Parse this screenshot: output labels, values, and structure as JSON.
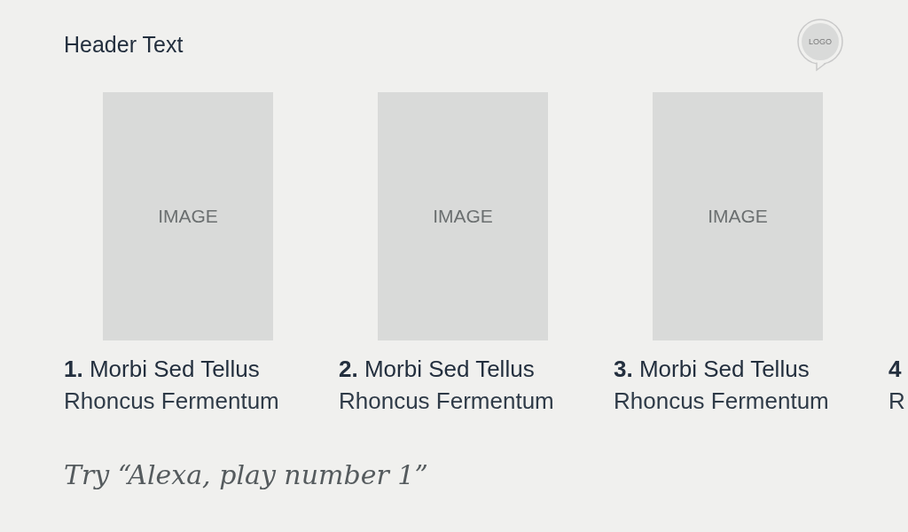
{
  "header": {
    "title": "Header Text",
    "logo": "LOGO"
  },
  "items": [
    {
      "image": "IMAGE",
      "number": "1.",
      "title": "Morbi Sed Tellus",
      "subtitle": "Rhoncus Fermentum"
    },
    {
      "image": "IMAGE",
      "number": "2.",
      "title": "Morbi Sed Tellus",
      "subtitle": "Rhoncus Fermentum"
    },
    {
      "image": "IMAGE",
      "number": "3.",
      "title": "Morbi Sed Tellus",
      "subtitle": "Rhoncus Fermentum"
    },
    {
      "number": "4",
      "subtitle": "R"
    }
  ],
  "hint": "Try “Alexa, play number 1”"
}
